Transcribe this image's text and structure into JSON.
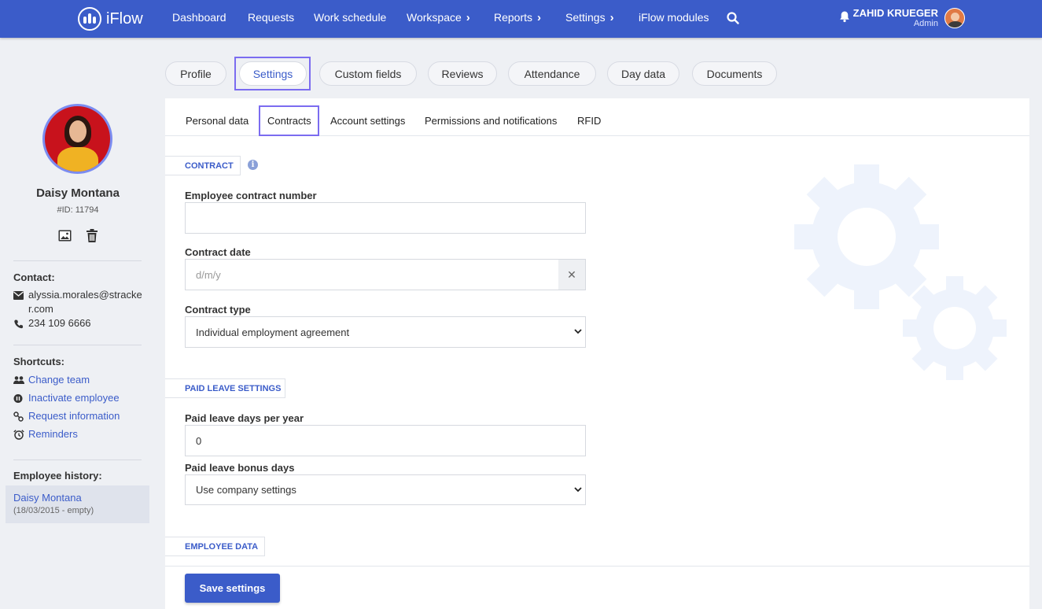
{
  "app": {
    "name": "iFlow"
  },
  "nav": {
    "dashboard": "Dashboard",
    "requests": "Requests",
    "work_schedule": "Work schedule",
    "workspace": "Workspace",
    "reports": "Reports",
    "settings": "Settings",
    "modules": "iFlow modules",
    "chevron": "›"
  },
  "user": {
    "name": "ZAHID KRUEGER",
    "role": "Admin"
  },
  "main_tabs": [
    "Profile",
    "Settings",
    "Custom fields",
    "Reviews",
    "Attendance",
    "Day data",
    "Documents"
  ],
  "sub_tabs": [
    "Personal data",
    "Contracts",
    "Account settings",
    "Permissions and notifications",
    "RFID"
  ],
  "employee": {
    "name": "Daisy Montana",
    "id": "#ID: 11794",
    "contact_title": "Contact:",
    "email": "alyssia.morales@stracker.com",
    "phone": "234 109 6666"
  },
  "shortcuts": {
    "title": "Shortcuts:",
    "items": [
      "Change team",
      "Inactivate employee",
      "Request information",
      "Reminders"
    ]
  },
  "history": {
    "title": "Employee history:",
    "name": "Daisy Montana",
    "date": "(18/03/2015 - empty)"
  },
  "contract_section": {
    "title": "CONTRACT",
    "info_glyph": "i",
    "number_label": "Employee contract number",
    "number_value": "",
    "date_label": "Contract date",
    "date_placeholder": "d/m/y",
    "clear_glyph": "✕",
    "type_label": "Contract type",
    "type_value": "Individual employment agreement"
  },
  "paid_leave_section": {
    "title": "PAID LEAVE SETTINGS",
    "days_label": "Paid leave days per year",
    "days_value": "0",
    "bonus_label": "Paid leave bonus days",
    "bonus_value": "Use company settings"
  },
  "employee_data_section": {
    "title": "EMPLOYEE DATA"
  },
  "actions": {
    "save": "Save settings"
  },
  "colors": {
    "primary": "#3b5cc9",
    "focus": "#7b6cf0",
    "background": "#eef0f4"
  }
}
